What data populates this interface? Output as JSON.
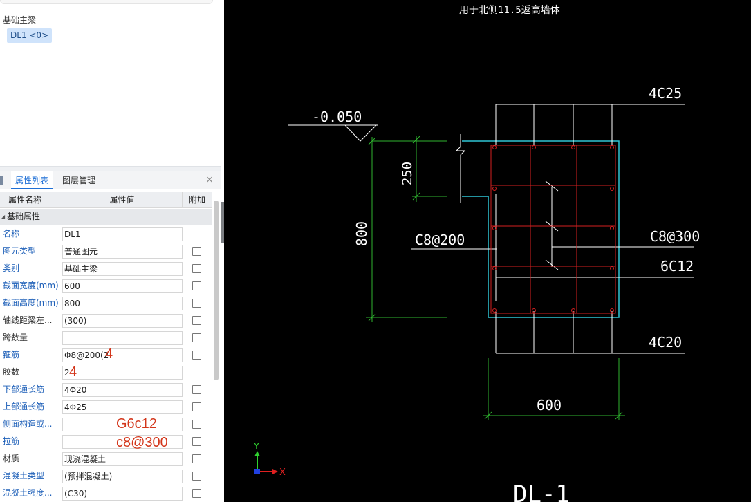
{
  "left_panel": {
    "group_title": "基础主梁",
    "selected_component": "DL1 <0>",
    "tabs": {
      "properties": "属性列表",
      "layers": "图层管理"
    },
    "close_glyph": "×",
    "columns": {
      "name": "属性名称",
      "value": "属性值",
      "extra": "附加"
    },
    "section": "基础属性",
    "properties": [
      {
        "name": "名称",
        "value": "DL1",
        "checkbox": false
      },
      {
        "name": "图元类型",
        "value": "普通图元",
        "checkbox": true
      },
      {
        "name": "类别",
        "value": "基础主梁",
        "checkbox": true
      },
      {
        "name": "截面宽度(mm)",
        "value": "600",
        "checkbox": true
      },
      {
        "name": "截面高度(mm)",
        "value": "800",
        "checkbox": true
      },
      {
        "name": "轴线距梁左...",
        "value": "(300)",
        "checkbox": true
      },
      {
        "name": "跨数量",
        "value": "",
        "checkbox": true
      },
      {
        "name": "箍筋",
        "value": "Φ8@200(2",
        "checkbox": true
      },
      {
        "name": "胶数",
        "value": "2",
        "checkbox": false
      },
      {
        "name": "下部通长筋",
        "value": "4Φ20",
        "checkbox": true
      },
      {
        "name": "上部通长筋",
        "value": "4Φ25",
        "checkbox": true
      },
      {
        "name": "侧面构造或...",
        "value": "",
        "checkbox": true
      },
      {
        "name": "拉筋",
        "value": "",
        "checkbox": true
      },
      {
        "name": "材质",
        "value": "现浇混凝土",
        "checkbox": true
      },
      {
        "name": "混凝土类型",
        "value": "(预拌混凝土)",
        "checkbox": true
      },
      {
        "name": "混凝土强度...",
        "value": "(C30)",
        "checkbox": true
      }
    ],
    "annotations": {
      "stirrup_legs": "4",
      "legs": "4",
      "side_bars": "G6c12",
      "tie_bars": "c8@300"
    }
  },
  "cad": {
    "header_note": "用于北侧11.5返高墙体",
    "elevation": "-0.050",
    "top_bars": "4C25",
    "bottom_bars": "4C20",
    "stirrup": "C8@200",
    "tie": "C8@300",
    "side_bars": "6C12",
    "dim_width": "600",
    "dim_height": "800",
    "dim_step": "250",
    "beam_label": "DL-1",
    "axis_x": "X",
    "axis_y": "Y"
  }
}
